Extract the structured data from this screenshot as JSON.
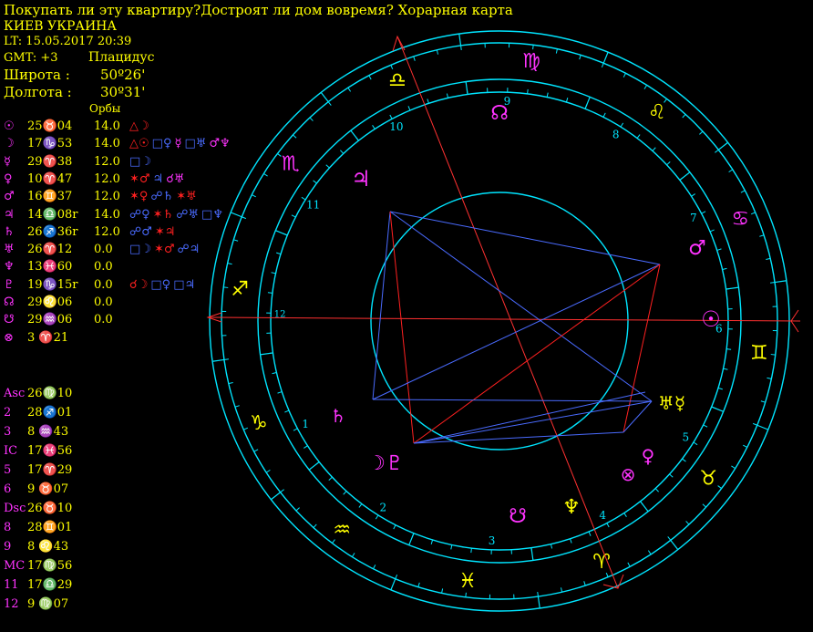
{
  "header": {
    "title": "Покупать ли эту квартиру?Достроят ли дом вовремя? Хорарная карта",
    "location": "КИЕВ УКРАИНА",
    "local_time": "LT: 15.05.2017  20:39",
    "gmt": "GMT: +3",
    "house_system": "Плацидус",
    "latitude_label": "Широта :",
    "latitude_value": "50º26'",
    "longitude_label": "Долгота :",
    "longitude_value": "30º31'",
    "orbs_label": "Орбы"
  },
  "colors": {
    "background": "#000000",
    "text": "#ffff00",
    "glyph": "#ff33ff",
    "ring": "#00e5ff",
    "axis": "#ff3030",
    "aspect_hard": "#ff2020",
    "aspect_soft": "#4a6bff"
  },
  "planets": [
    {
      "glyph": "☉",
      "pos": "25♉04",
      "orb": "14.0",
      "aspects": [
        {
          "s": "△☽",
          "c": "#ff2020"
        }
      ]
    },
    {
      "glyph": "☽",
      "pos": "17♑53",
      "orb": "14.0",
      "aspects": [
        {
          "s": "△☉",
          "c": "#ff2020"
        },
        {
          "s": "□♀",
          "c": "#4a6bff"
        },
        {
          "s": "☿",
          "c": "#ff33ff"
        },
        {
          "s": "□♅",
          "c": "#4a6bff"
        },
        {
          "s": "♂♆",
          "c": "#ff33ff"
        }
      ]
    },
    {
      "glyph": "☿",
      "pos": "29♈38",
      "orb": "12.0",
      "aspects": [
        {
          "s": "□☽",
          "c": "#4a6bff"
        }
      ]
    },
    {
      "glyph": "♀",
      "pos": "10♈47",
      "orb": "12.0",
      "aspects": [
        {
          "s": "✶♂",
          "c": "#ff2020"
        },
        {
          "s": "♃",
          "c": "#4a6bff"
        },
        {
          "s": "☌♅",
          "c": "#ff33ff"
        }
      ]
    },
    {
      "glyph": "♂",
      "pos": "16♊37",
      "orb": "12.0",
      "aspects": [
        {
          "s": "✶♀",
          "c": "#ff2020"
        },
        {
          "s": "☍♄",
          "c": "#4a6bff"
        },
        {
          "s": "✶♅",
          "c": "#ff2020"
        }
      ]
    },
    {
      "glyph": "♃",
      "pos": "14♎08r",
      "orb": "14.0",
      "aspects": [
        {
          "s": "☍♀",
          "c": "#4a6bff"
        },
        {
          "s": "✶♄",
          "c": "#ff2020"
        },
        {
          "s": "☍♅",
          "c": "#4a6bff"
        },
        {
          "s": "□♆",
          "c": "#4a6bff"
        }
      ]
    },
    {
      "glyph": "♄",
      "pos": "26♐36r",
      "orb": "12.0",
      "aspects": [
        {
          "s": "☍♂",
          "c": "#4a6bff"
        },
        {
          "s": "✶♃",
          "c": "#ff2020"
        }
      ]
    },
    {
      "glyph": "♅",
      "pos": "26♈12",
      "orb": "0.0",
      "aspects": [
        {
          "s": "□☽",
          "c": "#4a6bff"
        },
        {
          "s": "✶♂",
          "c": "#ff2020"
        },
        {
          "s": "☍♃",
          "c": "#4a6bff"
        }
      ]
    },
    {
      "glyph": "♆",
      "pos": "13♓60",
      "orb": "0.0",
      "aspects": []
    },
    {
      "glyph": "♇",
      "pos": "19♑15r",
      "orb": "0.0",
      "aspects": [
        {
          "s": "☌☽",
          "c": "#ff2020"
        },
        {
          "s": "□♀",
          "c": "#4a6bff"
        },
        {
          "s": "□♃",
          "c": "#4a6bff"
        }
      ]
    },
    {
      "glyph": "☊",
      "pos": "29♌06",
      "orb": "0.0",
      "aspects": []
    },
    {
      "glyph": "☋",
      "pos": "29♒06",
      "orb": "0.0",
      "aspects": []
    },
    {
      "glyph": "⊗",
      "pos": " 3 ♈21",
      "orb": "",
      "aspects": []
    }
  ],
  "houses": [
    {
      "name": "Asc",
      "pos": "26♍10"
    },
    {
      "name": "2",
      "pos": "28♐01"
    },
    {
      "name": "3",
      "pos": " 8 ♒43"
    },
    {
      "name": "IC",
      "pos": "17♓56"
    },
    {
      "name": "5",
      "pos": "17♈29"
    },
    {
      "name": "6",
      "pos": " 9 ♉07"
    },
    {
      "name": "Dsc",
      "pos": "26♉10"
    },
    {
      "name": "8",
      "pos": "28♊01"
    },
    {
      "name": "9",
      "pos": " 8 ♌43"
    },
    {
      "name": "MC",
      "pos": "17♍56"
    },
    {
      "name": "11",
      "pos": "17♎29"
    },
    {
      "name": "12",
      "pos": " 9 ♍07"
    }
  ],
  "wheel": {
    "signs": [
      {
        "glyph": "♍",
        "name": "virgo",
        "color": "#ff33ff"
      },
      {
        "glyph": "♌",
        "name": "leo",
        "color": "#ffff00"
      },
      {
        "glyph": "♋",
        "name": "cancer",
        "color": "#ff33ff"
      },
      {
        "glyph": "♊",
        "name": "gemini",
        "color": "#ffff00"
      },
      {
        "glyph": "♉",
        "name": "taurus",
        "color": "#ffff00"
      },
      {
        "glyph": "♈",
        "name": "aries",
        "color": "#ffff00"
      },
      {
        "glyph": "♓",
        "name": "pisces",
        "color": "#ffff00"
      },
      {
        "glyph": "♒",
        "name": "aquarius",
        "color": "#ffff00"
      },
      {
        "glyph": "♑",
        "name": "capricorn",
        "color": "#ffff00"
      },
      {
        "glyph": "♐",
        "name": "sagittarius",
        "color": "#ffff00"
      },
      {
        "glyph": "♏",
        "name": "scorpio",
        "color": "#ff33ff"
      },
      {
        "glyph": "♎",
        "name": "libra",
        "color": "#ffff00"
      }
    ],
    "house_numbers": [
      "9",
      "8",
      "7",
      "6",
      "5",
      "4",
      "3",
      "2",
      "1",
      "12",
      "11",
      "10"
    ],
    "planet_glyphs": [
      {
        "name": "sun",
        "glyph": "☉",
        "color": "#ff33ff"
      },
      {
        "name": "mars",
        "glyph": "♂",
        "color": "#ff33ff"
      },
      {
        "name": "uranus-mercury",
        "glyph": "♅☿",
        "color": "#ffff00"
      },
      {
        "name": "venus",
        "glyph": "♀",
        "color": "#ff33ff"
      },
      {
        "name": "fortuna",
        "glyph": "⊗",
        "color": "#ff33ff"
      },
      {
        "name": "neptune",
        "glyph": "♆",
        "color": "#ffff00"
      },
      {
        "name": "south-node",
        "glyph": "☋",
        "color": "#ff33ff"
      },
      {
        "name": "moon-pluto",
        "glyph": "☽♇",
        "color": "#ff33ff"
      },
      {
        "name": "saturn",
        "glyph": "♄",
        "color": "#ff33ff"
      },
      {
        "name": "jupiter",
        "glyph": "♃",
        "color": "#ff33ff"
      },
      {
        "name": "north-node",
        "glyph": "☊",
        "color": "#ff33ff"
      }
    ]
  }
}
